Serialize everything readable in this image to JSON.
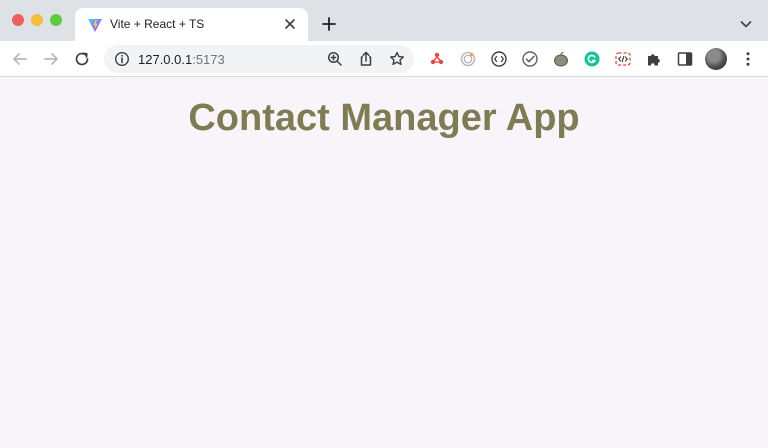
{
  "window": {
    "tab": {
      "title": "Vite + React + TS",
      "favicon": "vite-logo-icon"
    }
  },
  "address_bar": {
    "host": "127.0.0.1",
    "port": ":5173"
  },
  "extensions": [
    "extension-icon-1",
    "extension-icon-2",
    "extension-icon-3",
    "extension-icon-4",
    "extension-icon-5",
    "grammarly-icon",
    "extension-icon-7",
    "puzzle-icon"
  ],
  "page": {
    "heading": "Contact Manager App",
    "heading_color": "#7f7b52",
    "background": "#f7f5f9"
  }
}
